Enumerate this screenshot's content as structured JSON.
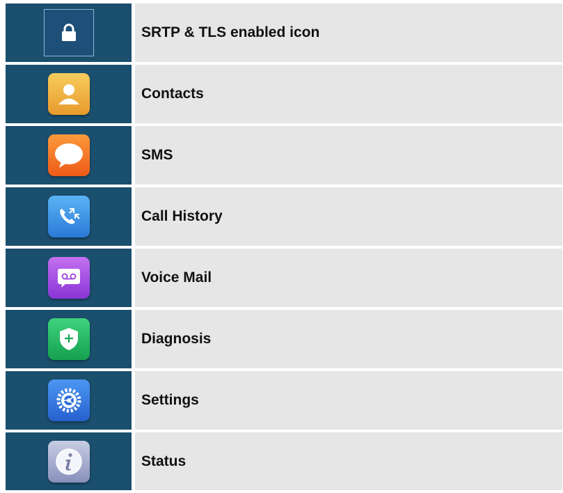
{
  "rows": [
    {
      "label": "SRTP & TLS enabled icon",
      "icon": "lock-icon"
    },
    {
      "label": "Contacts",
      "icon": "contacts-icon"
    },
    {
      "label": "SMS",
      "icon": "sms-icon"
    },
    {
      "label": "Call History",
      "icon": "call-history-icon"
    },
    {
      "label": "Voice Mail",
      "icon": "voice-mail-icon"
    },
    {
      "label": "Diagnosis",
      "icon": "diagnosis-icon"
    },
    {
      "label": "Settings",
      "icon": "settings-icon"
    },
    {
      "label": "Status",
      "icon": "status-icon"
    }
  ],
  "colors": {
    "icon_cell_bg": "#1b4f6e",
    "label_cell_bg": "#e6e6e6",
    "contacts": "#f0b440",
    "sms": "#f4782a",
    "call_history": "#3d95e6",
    "voice_mail": "#a44fe3",
    "diagnosis": "#26b964",
    "settings": "#3a7be0",
    "status": "#a8aed0"
  }
}
